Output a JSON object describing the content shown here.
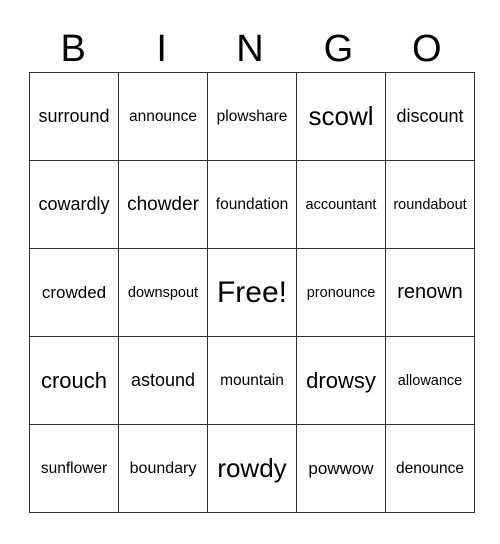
{
  "header": [
    "B",
    "I",
    "N",
    "G",
    "O"
  ],
  "rows": [
    [
      "surround",
      "announce",
      "plowshare",
      "scowl",
      "discount"
    ],
    [
      "cowardly",
      "chowder",
      "foundation",
      "accountant",
      "roundabout"
    ],
    [
      "crowded",
      "downspout",
      "Free!",
      "pronounce",
      "renown"
    ],
    [
      "crouch",
      "astound",
      "mountain",
      "drowsy",
      "allowance"
    ],
    [
      "sunflower",
      "boundary",
      "rowdy",
      "powwow",
      "denounce"
    ]
  ]
}
